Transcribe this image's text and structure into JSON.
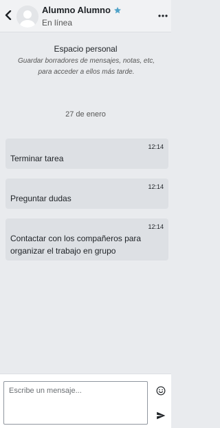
{
  "header": {
    "name": "Alumno Alumno",
    "status": "En línea"
  },
  "personal_space": {
    "title": "Espacio personal",
    "description": "Guardar borradores de mensajes, notas, etc, para acceder a ellos más tarde."
  },
  "date_separator": "27 de enero",
  "messages": [
    {
      "time": "12:14",
      "text": "Terminar tarea"
    },
    {
      "time": "12:14",
      "text": "Preguntar dudas"
    },
    {
      "time": "12:14",
      "text": "Contactar con los compañeros para organizar el trabajo en grupo"
    }
  ],
  "composer": {
    "placeholder": "Escribe un mensaje..."
  },
  "colors": {
    "star": "#4fa2c8",
    "background": "#e9ebee",
    "bubble": "#dde0e4"
  }
}
